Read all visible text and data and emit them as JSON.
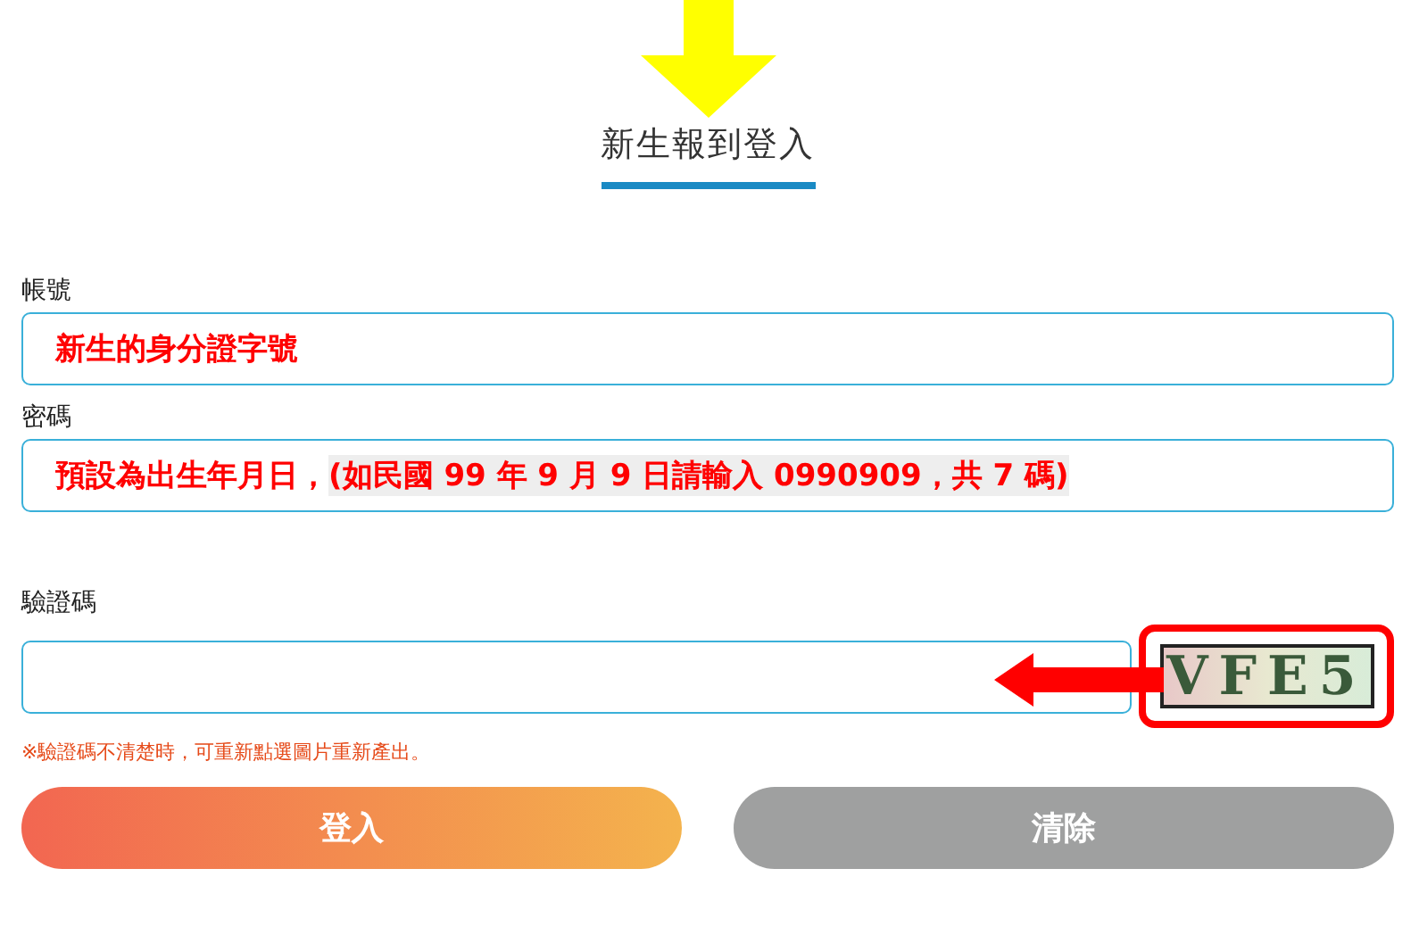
{
  "title": "新生報到登入",
  "account": {
    "label": "帳號",
    "annotation": "新生的身分證字號"
  },
  "password": {
    "label": "密碼",
    "annotation": "預設為出生年月日，",
    "annotation_highlight": "(如民國 99 年 9 月 9 日請輸入 0990909，共 7 碼)"
  },
  "captcha": {
    "label": "驗證碼",
    "code": "VFE5",
    "note": "※驗證碼不清楚時，可重新點選圖片重新產出。"
  },
  "buttons": [
    {
      "label": "登入",
      "kind": "primary"
    },
    {
      "label": "清除",
      "kind": "secondary"
    }
  ]
}
